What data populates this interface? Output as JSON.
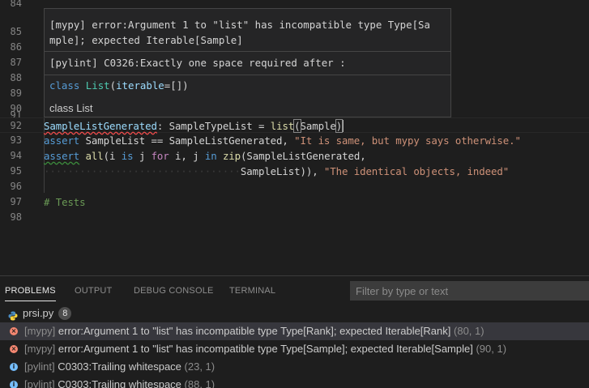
{
  "editor": {
    "line_numbers": [
      "84",
      "85",
      "86",
      "87",
      "88",
      "89",
      "90",
      "91",
      "92",
      "93",
      "94",
      "95",
      "96",
      "97",
      "98"
    ],
    "line92": {
      "var": "SampleListGenerated",
      "colon": ": ",
      "type": "SampleTypeList",
      "eq": " = ",
      "fn": "list",
      "open": "(",
      "arg": "Sample",
      "close": ")"
    },
    "line93": {
      "kw": "assert",
      "a": " SampleList == SampleListGenerated, ",
      "str": "\"It is same, but mypy says otherwise.\""
    },
    "line94": {
      "kw": "assert",
      "sp": " ",
      "fn_all": "all",
      "p1": "(i ",
      "is": "is",
      "p2": " j ",
      "for": "for",
      "p3": " i, j ",
      "in": "in",
      "sp2": " ",
      "fn_zip": "zip",
      "p4": "(SampleListGenerated,"
    },
    "line95": {
      "dots": "·································",
      "a": "SampleList)), ",
      "str": "\"The identical objects, indeed\""
    },
    "line97": {
      "comment": "# Tests"
    }
  },
  "hover": {
    "mypy_line1": "[mypy] error:Argument 1 to \"list\" has incompatible type Type[Sa",
    "mypy_line2": "mple]; expected Iterable[Sample]",
    "pylint": "[pylint] C0326:Exactly one space required after :",
    "sig_kw": "class",
    "sig_name": "List",
    "sig_open": "(",
    "sig_param": "iterable",
    "sig_rest": "=[])",
    "doc": "class List"
  },
  "panel": {
    "tabs": [
      "PROBLEMS",
      "OUTPUT",
      "DEBUG CONSOLE",
      "TERMINAL"
    ],
    "filter_placeholder": "Filter by type or text",
    "file": {
      "name": "prsi.py",
      "count": "8"
    },
    "problems": [
      {
        "severity": "error",
        "source": "[mypy]",
        "message": "error:Argument 1 to \"list\" has incompatible type Type[Rank]; expected Iterable[Rank]",
        "location": "(80, 1)"
      },
      {
        "severity": "error",
        "source": "[mypy]",
        "message": "error:Argument 1 to \"list\" has incompatible type Type[Sample]; expected Iterable[Sample]",
        "location": "(90, 1)"
      },
      {
        "severity": "info",
        "source": "[pylint]",
        "message": "C0303:Trailing whitespace",
        "location": "(23, 1)"
      },
      {
        "severity": "info",
        "source": "[pylint]",
        "message": "C0303:Trailing whitespace",
        "location": "(88, 1)"
      }
    ]
  },
  "colors": {
    "background": "#1e1e1e",
    "keyword": "#569cd6",
    "control_keyword": "#c586c0",
    "function": "#dcdcaa",
    "string": "#ce9178",
    "comment": "#6a9955",
    "error": "#f48771",
    "info": "#75beff"
  }
}
